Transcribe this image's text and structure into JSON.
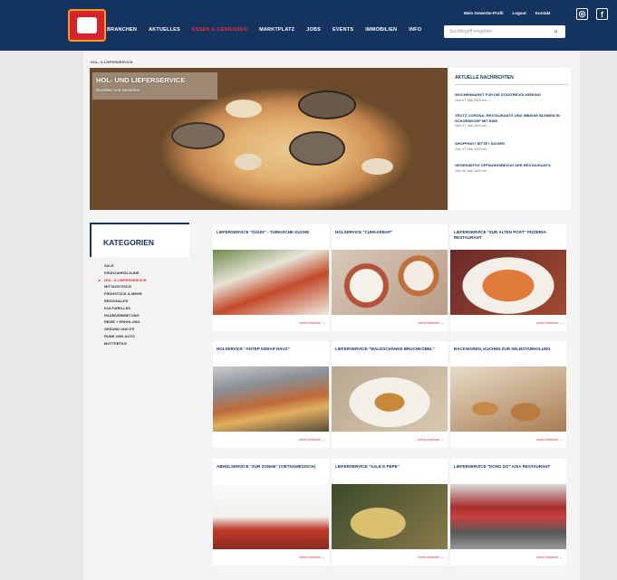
{
  "header": {
    "nav": [
      "BRANCHEN",
      "AKTUELLES",
      "ESSEN & GENIESSEN",
      "MARKTPLATZ",
      "JOBS",
      "EVENTS",
      "IMMOBILIEN",
      "INFO"
    ],
    "active_index": 2,
    "utility": [
      "Mein Gewerbe-Profil",
      "Logout",
      "Kontakt"
    ],
    "search_placeholder": "Suchbegriff eingeben",
    "search_icon": "search-icon",
    "social": [
      {
        "name": "instagram-icon",
        "glyph": "◎"
      },
      {
        "name": "facebook-icon",
        "glyph": "f"
      }
    ]
  },
  "breadcrumb": "HOL- & LIEFERSERVICE",
  "hero": {
    "title": "HOL- UND LIEFERSERVICE",
    "subtitle": "Bestellen und Genießen"
  },
  "news": {
    "heading": "AKTUELLE NACHRICHTEN",
    "items": [
      {
        "title": "WOCHENMARKT FÜR DIE STADTBEVÖLKERUNG",
        "date": "Vom 07. Mai 2020 ein"
      },
      {
        "title": "TROTZ CORONA: RESTAURANTS UND IMBISSE BLEIBEN IN SCHORNDORF MIT EINE",
        "date": "Vom 07. Mai 2020 ein"
      },
      {
        "title": "SHOPPING? BITTE? SICHER",
        "date": "Vom 07. Mai 2020 ein"
      },
      {
        "title": "GEGENSEITIG ÖFFNUNGSBEZUG DER RESTAURANTS",
        "date": "Vom 06. Mai 2020 ein"
      }
    ]
  },
  "categories": {
    "title": "KATEGORIEN",
    "active_index": 2,
    "items": [
      "SALE",
      "FRÜHJAHRSLAUNE",
      "HOL- & LIEFERSERVICE",
      "MITTAGSTISCH",
      "FRÜHSTÜCK & MEHR",
      "REGIONALES",
      "KULTURELLES",
      "RAUMVERMIETUNG",
      "REISE + ERHOLUNG",
      "GESUND UND FIT",
      "RUND UMS AUTO",
      "MUTTERTAG"
    ]
  },
  "cards": [
    {
      "title": "LIEFERSERVICE \"ÖGÜN\" - TÜRKISCHE KÜCHE",
      "link": "mehr erfahren →"
    },
    {
      "title": "HOLSERVICE \"CUMI-KEBAP\"",
      "link": "mehr erfahren →"
    },
    {
      "title": "LIEFERSERVICE \"ZUR ALTEN POST\" PIZZERIA-RESTAURANT",
      "link": "mehr erfahren →"
    },
    {
      "title": "HOLSERVICE \"ANTEP KEBAP HAUS\"",
      "link": "mehr erfahren →"
    },
    {
      "title": "LIEFERSERVICE \"WALDSCHÄNKE BRUCHKÖBEL\"",
      "link": "mehr erfahren →"
    },
    {
      "title": "BACKWAREN, KUCHEN ZUR SELBSTABHOLUNG",
      "link": "mehr erfahren →"
    },
    {
      "title": "ABHOLSERVICE \"ZUR SONNE\" (VIETNAMESISCH)",
      "link": "mehr erfahren →"
    },
    {
      "title": "LIEFERSERVICE \"SALE E PEPE\"",
      "link": "mehr erfahren →"
    },
    {
      "title": "LIEFERSERVICE \"DONG DO\" ASIA RESTAURANT",
      "link": "mehr erfahren →"
    }
  ],
  "colors": {
    "brand": "#14335f",
    "accent": "#d92a30"
  }
}
